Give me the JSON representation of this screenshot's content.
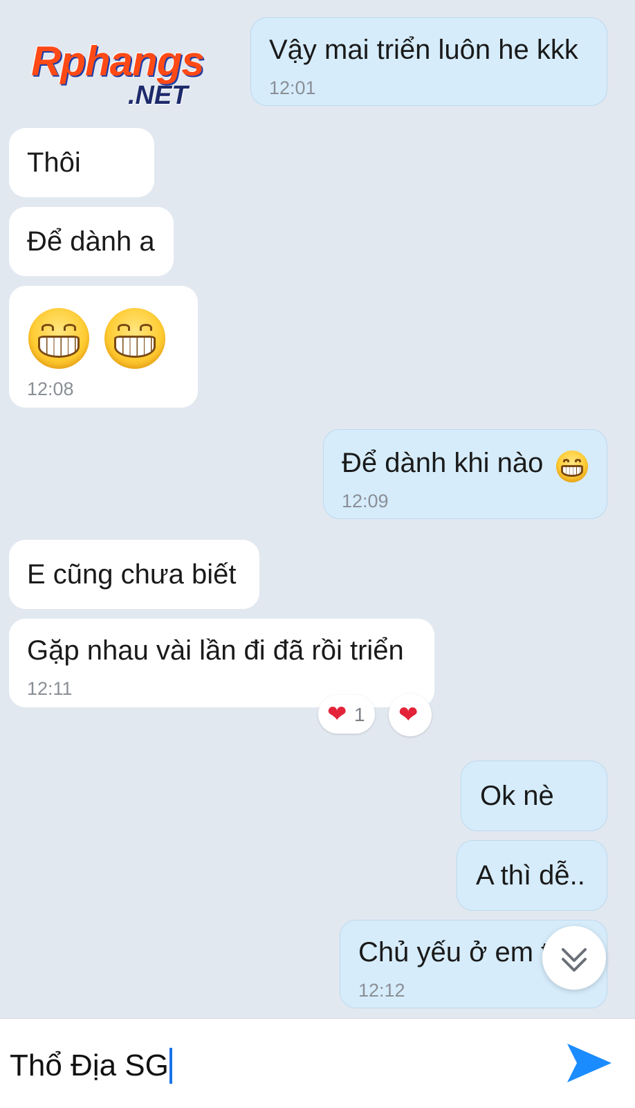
{
  "watermark": {
    "brand": "Rphangs",
    "suffix": ".NET"
  },
  "messages": [
    {
      "side": "out",
      "text": "Vậy mai triển luôn he kkk",
      "time": "12:01"
    },
    {
      "side": "in",
      "text": "Thôi"
    },
    {
      "side": "in",
      "text": "Để dành a"
    },
    {
      "side": "in",
      "emoji": [
        "grinning-face",
        "grinning-face"
      ],
      "time": "12:08"
    },
    {
      "side": "out",
      "text": "Để dành khi nào",
      "emoji": "grinning-face",
      "time": "12:09"
    },
    {
      "side": "in",
      "text": "E cũng chưa biết"
    },
    {
      "side": "in",
      "text": "Gặp nhau vài lần đi đã rồi triển",
      "time": "12:11",
      "reactions": {
        "heart_count": "1"
      }
    },
    {
      "side": "out",
      "text": "Ok nè"
    },
    {
      "side": "out",
      "text": "A thì dễ.."
    },
    {
      "side": "out",
      "text": "Chủ yếu ở em t",
      "time": "12:12"
    }
  ],
  "composer": {
    "value": "Thổ Địa SG"
  },
  "icons": {
    "scroll": "double-chevron-down-icon",
    "send": "send-arrow-icon",
    "reaction": "heart-icon"
  },
  "colors": {
    "background": "#e2e8f0",
    "incoming": "#ffffff",
    "outgoing": "#d6ecfb",
    "send": "#1a8cff",
    "heart": "#e2233a"
  }
}
